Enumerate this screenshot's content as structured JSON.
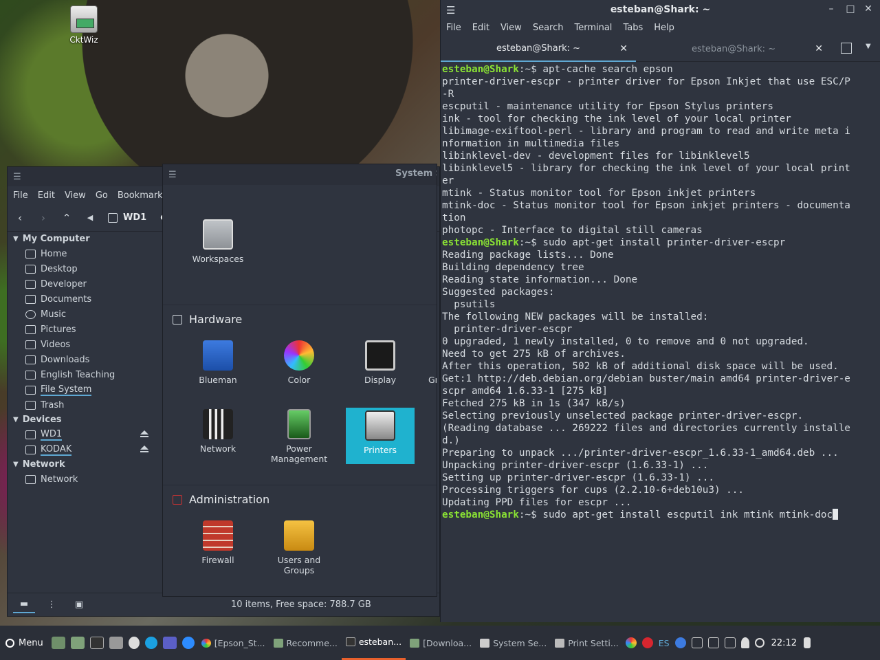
{
  "desktop": {
    "icon_label": "CktWiz"
  },
  "file_manager": {
    "menu": [
      "File",
      "Edit",
      "View",
      "Go",
      "Bookmarks"
    ],
    "breadcrumb": [
      "WD1",
      "co"
    ],
    "sections": {
      "my_computer": "My Computer",
      "devices": "Devices",
      "network": "Network"
    },
    "places": [
      "Home",
      "Desktop",
      "Developer",
      "Documents",
      "Music",
      "Pictures",
      "Videos",
      "Downloads",
      "English Teaching",
      "File System",
      "Trash"
    ],
    "devices": [
      "WD1",
      "KODAK"
    ],
    "network": [
      "Network"
    ],
    "status": "10 items, Free space: 788.7 GB"
  },
  "system_settings": {
    "title": "System S",
    "workspaces": "Workspaces",
    "hardware_title": "Hardware",
    "hardware": [
      "Blueman",
      "Color",
      "Display",
      "Network",
      "Power Management",
      "Printers"
    ],
    "cut_label": "Gr",
    "admin_title": "Administration",
    "admin": [
      "Firewall",
      "Users and Groups"
    ]
  },
  "terminal": {
    "title": "esteban@Shark: ~",
    "menu": [
      "File",
      "Edit",
      "View",
      "Search",
      "Terminal",
      "Tabs",
      "Help"
    ],
    "tabs": [
      "esteban@Shark: ~",
      "esteban@Shark: ~"
    ],
    "prompt_user": "esteban@Shark",
    "prompt_path": ":~$ ",
    "lines": [
      {
        "p": true,
        "t": "apt-cache search epson"
      },
      {
        "p": false,
        "t": "printer-driver-escpr - printer driver for Epson Inkjet that use ESC/P"
      },
      {
        "p": false,
        "t": "-R"
      },
      {
        "p": false,
        "t": "escputil - maintenance utility for Epson Stylus printers"
      },
      {
        "p": false,
        "t": "ink - tool for checking the ink level of your local printer"
      },
      {
        "p": false,
        "t": "libimage-exiftool-perl - library and program to read and write meta i"
      },
      {
        "p": false,
        "t": "nformation in multimedia files"
      },
      {
        "p": false,
        "t": "libinklevel-dev - development files for libinklevel5"
      },
      {
        "p": false,
        "t": "libinklevel5 - library for checking the ink level of your local print"
      },
      {
        "p": false,
        "t": "er"
      },
      {
        "p": false,
        "t": "mtink - Status monitor tool for Epson inkjet printers"
      },
      {
        "p": false,
        "t": "mtink-doc - Status monitor tool for Epson inkjet printers - documenta"
      },
      {
        "p": false,
        "t": "tion"
      },
      {
        "p": false,
        "t": "photopc - Interface to digital still cameras"
      },
      {
        "p": true,
        "t": "sudo apt-get install printer-driver-escpr"
      },
      {
        "p": false,
        "t": "Reading package lists... Done"
      },
      {
        "p": false,
        "t": "Building dependency tree"
      },
      {
        "p": false,
        "t": "Reading state information... Done"
      },
      {
        "p": false,
        "t": "Suggested packages:"
      },
      {
        "p": false,
        "t": "  psutils"
      },
      {
        "p": false,
        "t": "The following NEW packages will be installed:"
      },
      {
        "p": false,
        "t": "  printer-driver-escpr"
      },
      {
        "p": false,
        "t": "0 upgraded, 1 newly installed, 0 to remove and 0 not upgraded."
      },
      {
        "p": false,
        "t": "Need to get 275 kB of archives."
      },
      {
        "p": false,
        "t": "After this operation, 502 kB of additional disk space will be used."
      },
      {
        "p": false,
        "t": "Get:1 http://deb.debian.org/debian buster/main amd64 printer-driver-e"
      },
      {
        "p": false,
        "t": "scpr amd64 1.6.33-1 [275 kB]"
      },
      {
        "p": false,
        "t": "Fetched 275 kB in 1s (347 kB/s)"
      },
      {
        "p": false,
        "t": "Selecting previously unselected package printer-driver-escpr."
      },
      {
        "p": false,
        "t": "(Reading database ... 269222 files and directories currently installe"
      },
      {
        "p": false,
        "t": "d.)"
      },
      {
        "p": false,
        "t": "Preparing to unpack .../printer-driver-escpr_1.6.33-1_amd64.deb ..."
      },
      {
        "p": false,
        "t": "Unpacking printer-driver-escpr (1.6.33-1) ..."
      },
      {
        "p": false,
        "t": "Setting up printer-driver-escpr (1.6.33-1) ..."
      },
      {
        "p": false,
        "t": "Processing triggers for cups (2.2.10-6+deb10u3) ..."
      },
      {
        "p": false,
        "t": "Updating PPD files for escpr ..."
      },
      {
        "p": true,
        "t": "sudo apt-get install escputil ink mtink mtink-doc",
        "cursor": true
      }
    ]
  },
  "taskbar": {
    "menu_label": "Menu",
    "tasks": [
      "[Epson_St...",
      "Recomme...",
      "esteban...",
      "[Downloa...",
      "System Se...",
      "Print Setti..."
    ],
    "keyboard_layout": "ES",
    "clock": "22:12"
  },
  "colors": {
    "accent": "#5fa8d3",
    "selection": "#1fb2cf",
    "prompt": "#8ae234",
    "active_task": "#e8602c"
  }
}
